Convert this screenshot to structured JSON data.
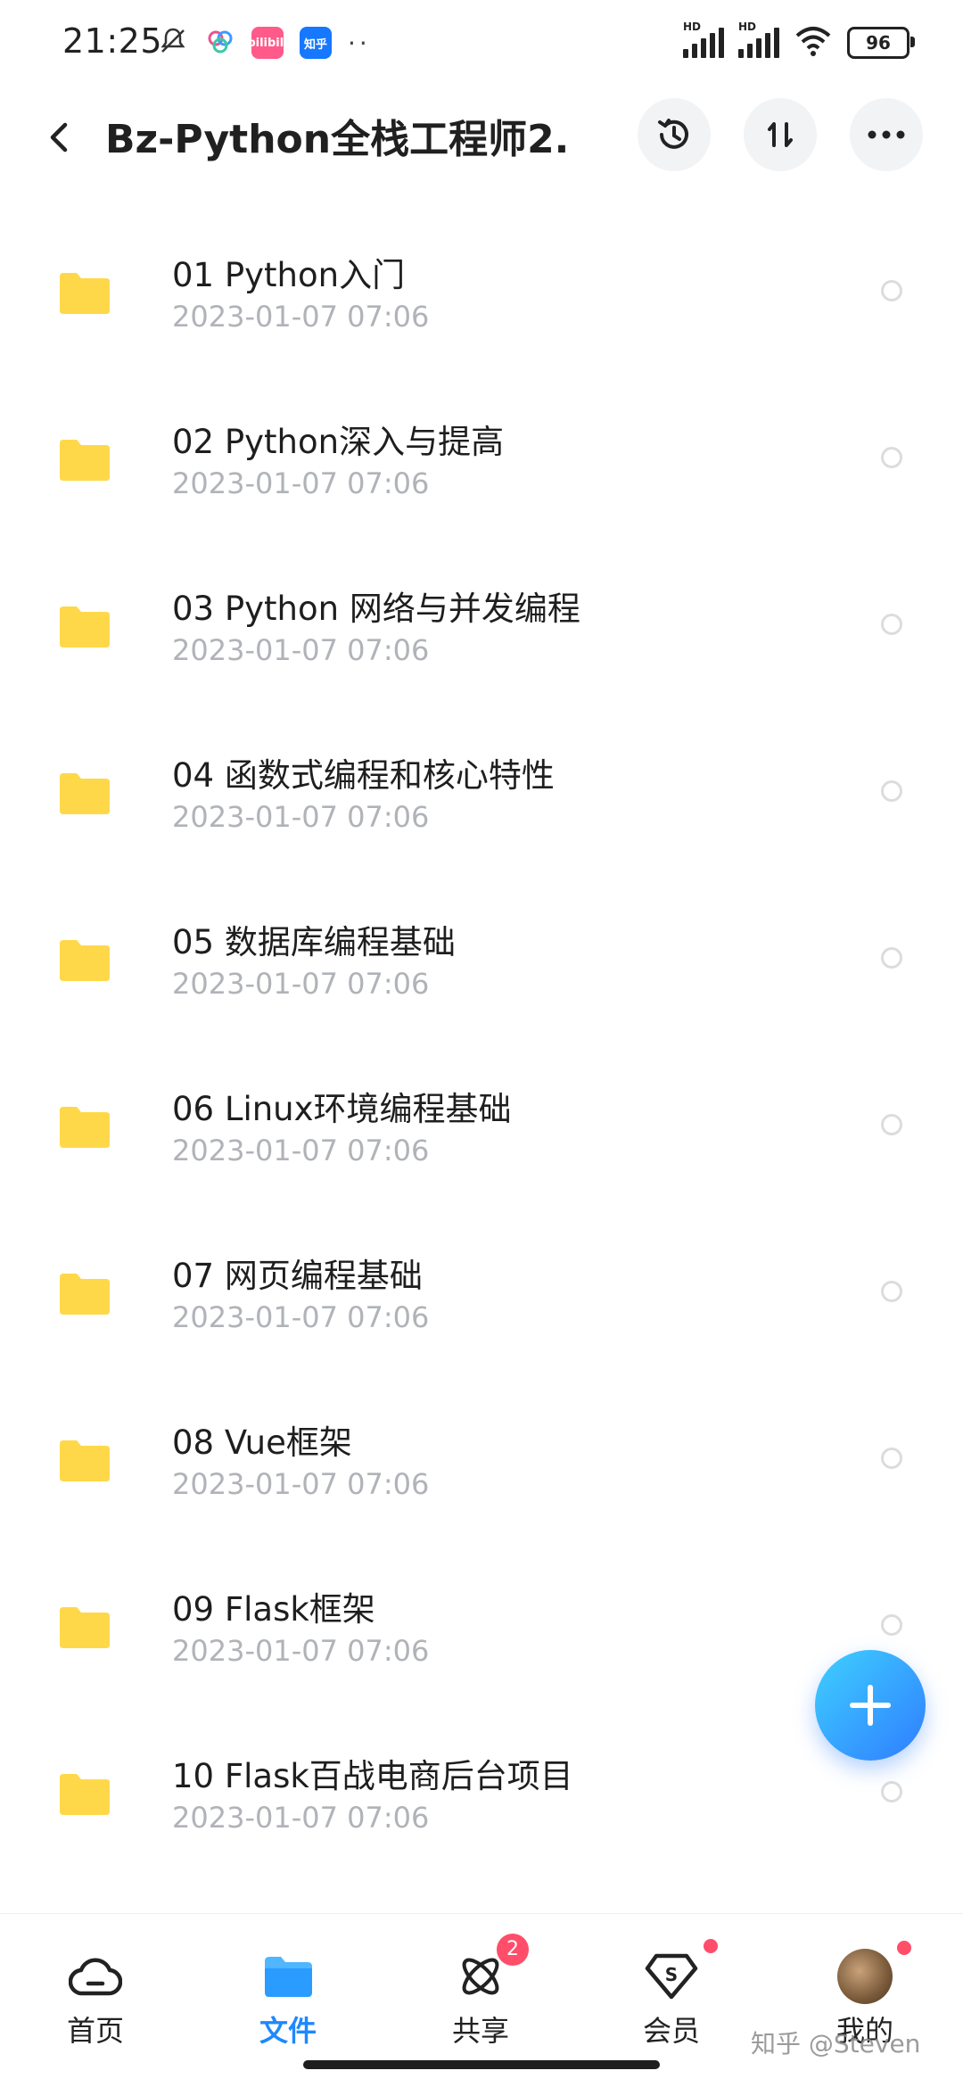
{
  "status_bar": {
    "time": "21:25",
    "app_badges": [
      "bilibili",
      "知乎"
    ],
    "dots": "··",
    "signal_labels": [
      "HD",
      "HD"
    ],
    "battery": "96"
  },
  "header": {
    "title": "Bz-Python全栈工程师2...",
    "icons": [
      "back-arrow-icon",
      "history-icon",
      "sort-icon",
      "more-icon"
    ]
  },
  "files": [
    {
      "name": "01 Python入门",
      "date": "2023-01-07  07:06"
    },
    {
      "name": "02 Python深入与提高",
      "date": "2023-01-07  07:06"
    },
    {
      "name": "03 Python 网络与并发编程",
      "date": "2023-01-07  07:06"
    },
    {
      "name": "04 函数式编程和核心特性",
      "date": "2023-01-07  07:06"
    },
    {
      "name": "05 数据库编程基础",
      "date": "2023-01-07  07:06"
    },
    {
      "name": "06 Linux环境编程基础",
      "date": "2023-01-07  07:06"
    },
    {
      "name": "07 网页编程基础",
      "date": "2023-01-07  07:06"
    },
    {
      "name": "08 Vue框架",
      "date": "2023-01-07  07:06"
    },
    {
      "name": "09 Flask框架",
      "date": "2023-01-07  07:06"
    },
    {
      "name": "10 Flask百战电商后台项目",
      "date": "2023-01-07  07:06"
    }
  ],
  "bottom_nav": {
    "items": [
      {
        "label": "首页"
      },
      {
        "label": "文件"
      },
      {
        "label": "共享",
        "badge": "2"
      },
      {
        "label": "会员"
      },
      {
        "label": "我的"
      }
    ],
    "active": "文件"
  },
  "watermark": "知乎 @Steven",
  "colors": {
    "accent": "#1e88ff",
    "folder": "#ffd84a",
    "badge": "#ff4d6a",
    "date_text": "#b0b3b8"
  }
}
